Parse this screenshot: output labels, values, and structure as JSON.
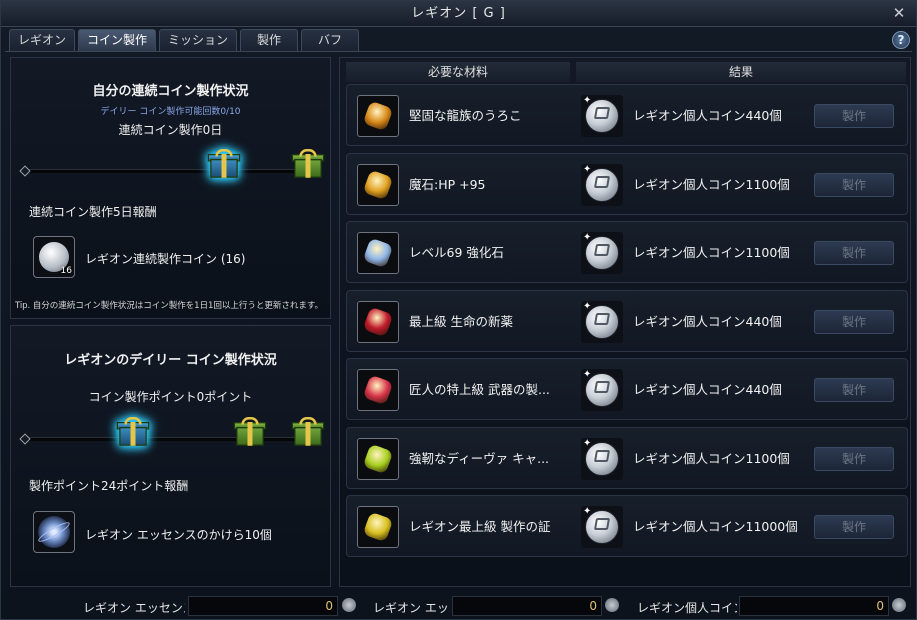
{
  "window": {
    "title": "レギオン [ G ]",
    "close_glyph": "✕",
    "help_glyph": "?"
  },
  "tabs": [
    {
      "label": "レギオン",
      "active": false
    },
    {
      "label": "コイン製作",
      "active": true
    },
    {
      "label": "ミッション",
      "active": false
    },
    {
      "label": "製作",
      "active": false
    },
    {
      "label": "バフ",
      "active": false
    }
  ],
  "personal": {
    "title": "自分の連続コイン製作状況",
    "subtitle": "デイリー コイン製作可能回数0/10",
    "status": "連続コイン製作0日",
    "reward_title": "連続コイン製作5日報酬",
    "reward_item": "レギオン連続製作コイン (16)",
    "reward_count": "16",
    "tip": "Tip. 自分の連続コイン製作状況はコイン製作を1日1回以上行うと更新されます。"
  },
  "legion": {
    "title": "レギオンのデイリー コイン製作状況",
    "status": "コイン製作ポイント0ポイント",
    "reward_title": "製作ポイント24ポイント報酬",
    "reward_item": "レギオン エッセンスのかけら10個"
  },
  "recipes_header": {
    "materials": "必要な材料",
    "result": "結果"
  },
  "recipes": [
    {
      "material": "堅固な龍族のうろこ",
      "result": "レギオン個人コイン440個",
      "button": "製作",
      "icon": "dragon-scale-icon",
      "color": "#d98a1a"
    },
    {
      "material": "魔石:HP +95",
      "result": "レギオン個人コイン1100個",
      "button": "製作",
      "icon": "manastone-icon",
      "color": "#e0a020"
    },
    {
      "material": "レベル69 強化石",
      "result": "レギオン個人コイン1100個",
      "button": "製作",
      "icon": "enchant-stone-icon",
      "color": "#8fb6e8"
    },
    {
      "material": "最上級 生命の新薬",
      "result": "レギオン個人コイン440個",
      "button": "製作",
      "icon": "life-potion-icon",
      "color": "#c01a2a"
    },
    {
      "material": "匠人の特上級 武器の製...",
      "result": "レギオン個人コイン440個",
      "button": "製作",
      "icon": "weapon-material-icon",
      "color": "#d8344a"
    },
    {
      "material": "強靭なディーヴァ キャ...",
      "result": "レギオン個人コイン1100個",
      "button": "製作",
      "icon": "daeva-silhouette-icon",
      "color": "#a8d020"
    },
    {
      "material": "レギオン最上級 製作の証",
      "result": "レギオン個人コイン11000個",
      "button": "製作",
      "icon": "crafting-proof-icon",
      "color": "#d8c020"
    }
  ],
  "currencies": [
    {
      "label": "レギオン エッセンス",
      "value": "0",
      "icon": "essence-icon"
    },
    {
      "label": "レギオン エッ",
      "value": "0",
      "icon": "essence-shard-icon"
    },
    {
      "label": "レギオン個人コイン",
      "value": "0",
      "icon": "coin-icon"
    }
  ]
}
